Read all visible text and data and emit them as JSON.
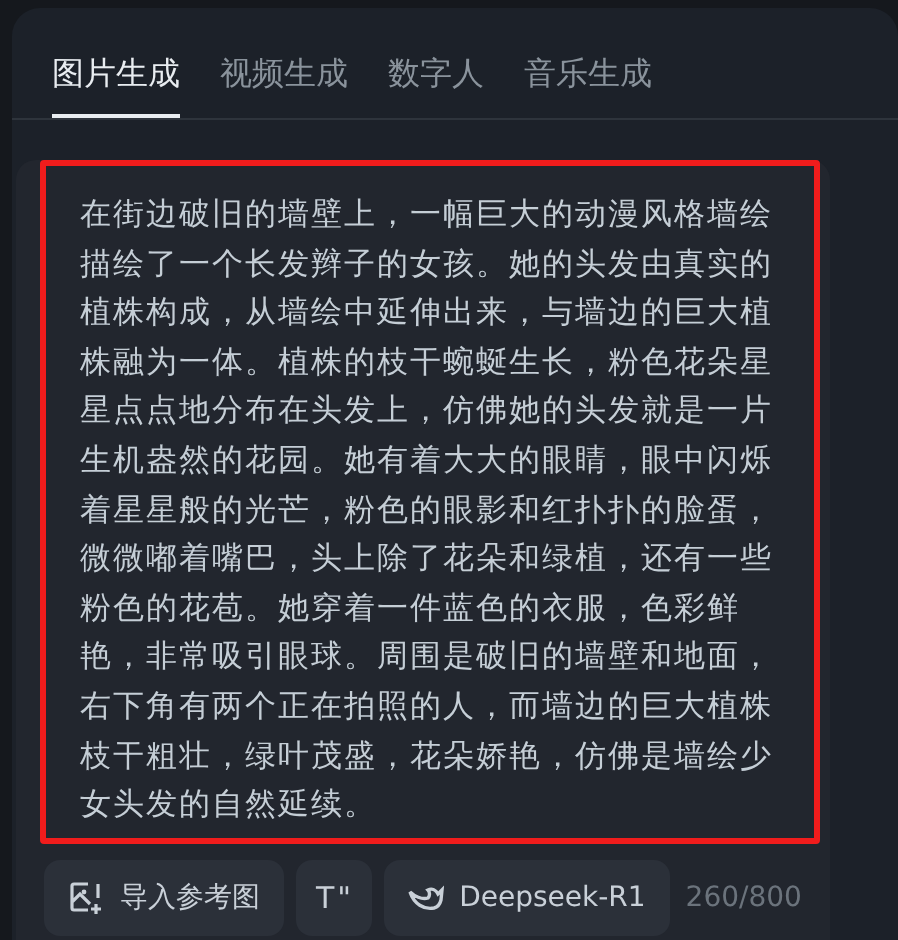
{
  "tabs": [
    {
      "label": "图片生成",
      "selected": true
    },
    {
      "label": "视频生成",
      "selected": false
    },
    {
      "label": "数字人",
      "selected": false
    },
    {
      "label": "音乐生成",
      "selected": false
    }
  ],
  "prompt": {
    "value": "在街边破旧的墙壁上，一幅巨大的动漫风格墙绘描绘了一个长发辫子的女孩。她的头发由真实的植株构成，从墙绘中延伸出来，与墙边的巨大植株融为一体。植株的枝干蜿蜒生长，粉色花朵星星点点地分布在头发上，仿佛她的头发就是一片生机盎然的花园。她有着大大的眼睛，眼中闪烁着星星般的光芒，粉色的眼影和红扑扑的脸蛋，微微嘟着嘴巴，头上除了花朵和绿植，还有一些粉色的花苞。她穿着一件蓝色的衣服，色彩鲜艳，非常吸引眼球。周围是破旧的墙壁和地面，右下角有两个正在拍照的人，而墙边的巨大植株枝干粗壮，绿叶茂盛，花朵娇艳，仿佛是墙绘少女头发的自然延续。",
    "highlighted": true
  },
  "toolbar": [
    {
      "kind": "upload",
      "label": "导入参考图"
    },
    {
      "kind": "format",
      "label": "T \""
    },
    {
      "kind": "model",
      "label": "Deepseek-R1"
    }
  ],
  "char_count": "260/800"
}
